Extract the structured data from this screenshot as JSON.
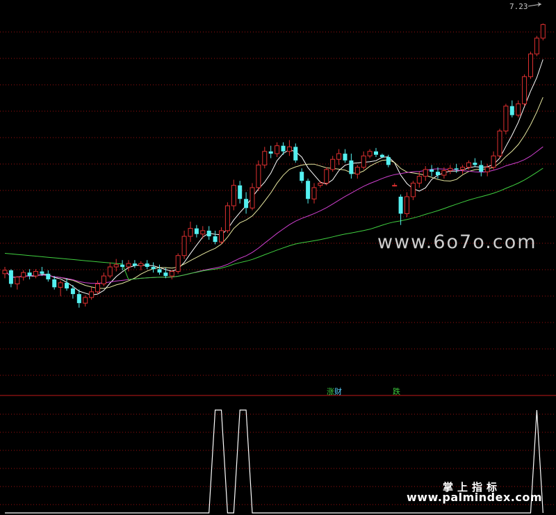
{
  "price_label": "7.23",
  "signal_flags": {
    "rise_text_1": "涨",
    "rise_text_2": "财",
    "fall_text": "跌"
  },
  "watermarks": {
    "site_top": "www.6o7o.com",
    "brand_cn": "掌上指标",
    "site_bottom": "www.palmindex.com"
  },
  "colors": {
    "background": "#000000",
    "up_candle": "#e03030",
    "down_candle": "#54f0f0",
    "ma_short": "#ffffff",
    "ma_mid": "#e8e8a0",
    "ma_long": "#d040d0",
    "ma_trend": "#40d040",
    "grid": "#a01010",
    "separator": "#c01818",
    "indicator": "#ffffff"
  },
  "chart_data": {
    "type": "candlestick",
    "price_pane": {
      "ylim": [
        4.0,
        7.4
      ],
      "grid": "dotted-horizontal"
    },
    "candles": [
      [
        5.02,
        5.08,
        4.98,
        5.05
      ],
      [
        5.05,
        5.06,
        4.9,
        4.93
      ],
      [
        4.93,
        5.0,
        4.88,
        4.99
      ],
      [
        4.99,
        5.05,
        4.96,
        5.03
      ],
      [
        5.03,
        5.06,
        4.97,
        5.0
      ],
      [
        5.0,
        5.06,
        4.98,
        5.04
      ],
      [
        5.04,
        5.08,
        5.0,
        5.02
      ],
      [
        5.02,
        5.05,
        4.95,
        4.97
      ],
      [
        4.97,
        5.0,
        4.88,
        4.9
      ],
      [
        4.9,
        4.96,
        4.82,
        4.94
      ],
      [
        4.94,
        4.98,
        4.87,
        4.89
      ],
      [
        4.89,
        4.92,
        4.8,
        4.84
      ],
      [
        4.84,
        4.88,
        4.72,
        4.76
      ],
      [
        4.76,
        4.83,
        4.73,
        4.81
      ],
      [
        4.81,
        4.9,
        4.79,
        4.86
      ],
      [
        4.86,
        4.96,
        4.84,
        4.93
      ],
      [
        4.93,
        5.03,
        4.91,
        5.0
      ],
      [
        5.0,
        5.12,
        4.98,
        5.08
      ],
      [
        5.08,
        5.15,
        5.04,
        5.1
      ],
      [
        5.1,
        5.14,
        5.05,
        5.08
      ],
      [
        5.08,
        5.14,
        5.04,
        5.11
      ],
      [
        5.11,
        5.14,
        5.07,
        5.09
      ],
      [
        5.09,
        5.13,
        5.05,
        5.11
      ],
      [
        5.11,
        5.14,
        5.06,
        5.08
      ],
      [
        5.08,
        5.12,
        5.03,
        5.06
      ],
      [
        5.06,
        5.1,
        5.01,
        5.03
      ],
      [
        5.03,
        5.07,
        4.98,
        5.0
      ],
      [
        5.0,
        5.05,
        4.97,
        5.04
      ],
      [
        5.04,
        5.2,
        5.02,
        5.18
      ],
      [
        5.18,
        5.4,
        5.15,
        5.35
      ],
      [
        5.35,
        5.48,
        5.3,
        5.42
      ],
      [
        5.42,
        5.45,
        5.34,
        5.37
      ],
      [
        5.37,
        5.44,
        5.33,
        5.4
      ],
      [
        5.4,
        5.44,
        5.32,
        5.35
      ],
      [
        5.35,
        5.4,
        5.28,
        5.3
      ],
      [
        5.3,
        5.43,
        5.28,
        5.4
      ],
      [
        5.4,
        5.65,
        5.38,
        5.62
      ],
      [
        5.62,
        5.85,
        5.58,
        5.8
      ],
      [
        5.8,
        5.84,
        5.64,
        5.68
      ],
      [
        5.68,
        5.74,
        5.55,
        5.6
      ],
      [
        5.6,
        5.82,
        5.58,
        5.78
      ],
      [
        5.78,
        6.02,
        5.75,
        5.98
      ],
      [
        5.98,
        6.14,
        5.95,
        6.1
      ],
      [
        6.1,
        6.15,
        6.04,
        6.08
      ],
      [
        6.08,
        6.18,
        6.05,
        6.15
      ],
      [
        6.15,
        6.18,
        6.07,
        6.1
      ],
      [
        6.1,
        6.2,
        6.06,
        6.14
      ],
      [
        6.14,
        6.17,
        6.0,
        6.02
      ],
      [
        5.92,
        5.95,
        5.82,
        5.84
      ],
      [
        5.84,
        5.86,
        5.64,
        5.68
      ],
      [
        5.68,
        5.82,
        5.64,
        5.78
      ],
      [
        5.8,
        5.84,
        5.78,
        5.82
      ],
      [
        5.82,
        5.96,
        5.8,
        5.94
      ],
      [
        5.94,
        6.06,
        5.92,
        6.03
      ],
      [
        6.03,
        6.12,
        5.98,
        6.08
      ],
      [
        6.08,
        6.12,
        6.0,
        6.02
      ],
      [
        6.02,
        6.08,
        5.86,
        5.9
      ],
      [
        5.9,
        5.98,
        5.86,
        5.96
      ],
      [
        5.96,
        6.1,
        5.94,
        6.06
      ],
      [
        6.06,
        6.12,
        6.04,
        6.1
      ],
      [
        6.1,
        6.13,
        6.05,
        6.07
      ],
      [
        6.07,
        6.08,
        6.04,
        6.05
      ],
      [
        6.05,
        6.07,
        5.96,
        5.98
      ],
      [
        5.8,
        5.82,
        5.79,
        5.8
      ],
      [
        5.7,
        5.72,
        5.45,
        5.55
      ],
      [
        5.55,
        5.74,
        5.52,
        5.7
      ],
      [
        5.7,
        5.84,
        5.67,
        5.82
      ],
      [
        5.82,
        5.92,
        5.78,
        5.88
      ],
      [
        5.88,
        5.97,
        5.84,
        5.94
      ],
      [
        5.94,
        5.98,
        5.88,
        5.92
      ],
      [
        5.92,
        5.96,
        5.86,
        5.89
      ],
      [
        5.89,
        5.96,
        5.86,
        5.93
      ],
      [
        5.93,
        5.98,
        5.9,
        5.95
      ],
      [
        5.95,
        5.99,
        5.91,
        5.94
      ],
      [
        5.94,
        5.98,
        5.9,
        5.96
      ],
      [
        5.96,
        6.02,
        5.94,
        6.0
      ],
      [
        6.0,
        6.04,
        5.96,
        5.98
      ],
      [
        5.98,
        6.02,
        5.88,
        5.92
      ],
      [
        5.92,
        5.99,
        5.88,
        5.96
      ],
      [
        5.96,
        6.1,
        5.94,
        6.06
      ],
      [
        6.06,
        6.3,
        6.04,
        6.28
      ],
      [
        6.28,
        6.52,
        6.25,
        6.5
      ],
      [
        6.5,
        6.55,
        6.4,
        6.42
      ],
      [
        6.42,
        6.55,
        6.4,
        6.52
      ],
      [
        6.52,
        6.78,
        6.5,
        6.76
      ],
      [
        6.76,
        6.98,
        6.74,
        6.96
      ],
      [
        6.96,
        7.12,
        6.94,
        7.1
      ],
      [
        7.1,
        7.23,
        7.08,
        7.22
      ]
    ],
    "ma_windows": [
      5,
      10,
      30,
      60
    ],
    "signal": {
      "ylim": [
        0,
        1
      ],
      "values": [
        0,
        0,
        0,
        0,
        0,
        0,
        0,
        0,
        0,
        0,
        0,
        0,
        0,
        0,
        0,
        0,
        0,
        0,
        0,
        0,
        0,
        0,
        0,
        0,
        0,
        0,
        0,
        0,
        0,
        0,
        0,
        0,
        0,
        0,
        1,
        1,
        0,
        0,
        1,
        1,
        0,
        0,
        0,
        0,
        0,
        0,
        0,
        0,
        0,
        0,
        0,
        0,
        0,
        0,
        0,
        0,
        0,
        0,
        0,
        0,
        0,
        0,
        0,
        0,
        0,
        0,
        0,
        0,
        0,
        0,
        0,
        0,
        0,
        0,
        0,
        0,
        0,
        0,
        0,
        0,
        0,
        0,
        0,
        0,
        0,
        0,
        1,
        0
      ]
    }
  }
}
